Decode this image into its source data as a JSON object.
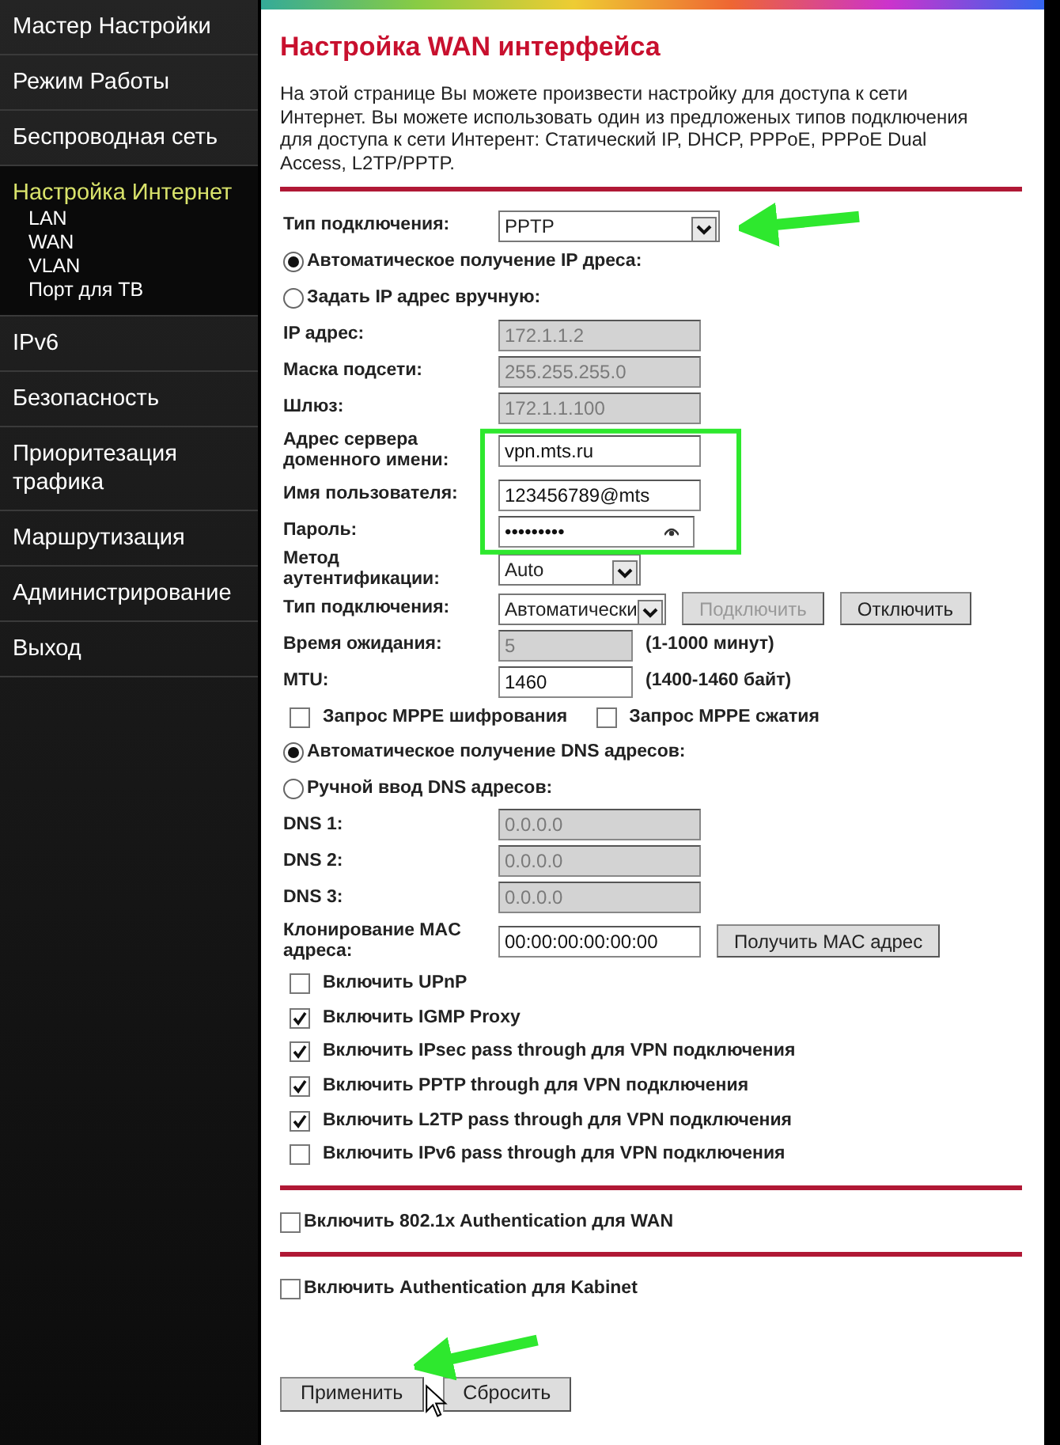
{
  "sidebar": {
    "items": [
      {
        "label": "Мастер Настройки",
        "selected": false
      },
      {
        "label": "Режим Работы",
        "selected": false
      },
      {
        "label": "Беспроводная сеть",
        "selected": false
      },
      {
        "label": "Настройка Интернет",
        "selected": true,
        "children": [
          {
            "label": "LAN"
          },
          {
            "label": "WAN"
          },
          {
            "label": "VLAN"
          },
          {
            "label": "Порт для ТВ"
          }
        ]
      },
      {
        "label": "IPv6",
        "selected": false
      },
      {
        "label": "Безопасность",
        "selected": false
      },
      {
        "label": "Приоритезация трафика",
        "selected": false
      },
      {
        "label": "Маршрутизация",
        "selected": false
      },
      {
        "label": "Администрирование",
        "selected": false
      },
      {
        "label": "Выход",
        "selected": false
      }
    ]
  },
  "page": {
    "title": "Настройка WAN интерфейса",
    "description": "На этой странице Вы можете произвести настройку для доступа к сети Интернет. Вы можете использовать один из предложеных типов подключения для доступа к сети Интерент: Статический IP, DHCP, PPPoE, PPPoE Dual Access, L2TP/PPTP."
  },
  "sections": [
    {
      "rows": [
        {
          "kind": "select",
          "label": "Тип подключения:",
          "value": "PPTP"
        },
        {
          "kind": "radio",
          "label": "Автоматическое получение IP дреса:",
          "selected": true
        },
        {
          "kind": "radio",
          "label": "Задать IP адрес вручную:",
          "selected": false
        },
        {
          "kind": "input",
          "label": "IP адрес:",
          "value": "172.1.1.2",
          "disabled": true
        },
        {
          "kind": "input",
          "label": "Маска подсети:",
          "value": "255.255.255.0",
          "disabled": true
        },
        {
          "kind": "input",
          "label": "Шлюз:",
          "value": "172.1.1.100",
          "disabled": true
        },
        {
          "kind": "input",
          "label": "Адрес сервера доменного имени:",
          "value": "vpn.mts.ru",
          "disabled": false
        },
        {
          "kind": "input",
          "label": "Имя пользователя:",
          "value": "123456789@mts",
          "disabled": false
        },
        {
          "kind": "password",
          "label": "Пароль:",
          "value": "•••••••••"
        },
        {
          "kind": "select",
          "label": "Метод аутентификации:",
          "value": "Auto"
        },
        {
          "kind": "select",
          "label": "Тип подключения:",
          "value": "Автоматически",
          "buttons": [
            {
              "label": "Подключить",
              "disabled": true
            },
            {
              "label": "Отключить",
              "disabled": false
            }
          ]
        },
        {
          "kind": "input",
          "label": "Время ожидания:",
          "value": "5",
          "disabled": true,
          "hint": "(1-1000 минут)"
        },
        {
          "kind": "input",
          "label": "MTU:",
          "value": "1460",
          "disabled": false,
          "hint": "(1400-1460 байт)"
        },
        {
          "kind": "checkboxes",
          "items": [
            {
              "label": "Запрос MPPE шифрования",
              "checked": false
            },
            {
              "label": "Запрос MPPE сжатия",
              "checked": false
            }
          ]
        },
        {
          "kind": "radio",
          "label": "Автоматическое получение DNS адресов:",
          "selected": true
        },
        {
          "kind": "radio",
          "label": "Ручной ввод DNS адресов:",
          "selected": false
        },
        {
          "kind": "input",
          "label": "DNS 1:",
          "value": "0.0.0.0",
          "disabled": true
        },
        {
          "kind": "input",
          "label": "DNS 2:",
          "value": "0.0.0.0",
          "disabled": true
        },
        {
          "kind": "input",
          "label": "DNS 3:",
          "value": "0.0.0.0",
          "disabled": true
        },
        {
          "kind": "input",
          "label": "Клонирование MAC адреса:",
          "value": "00:00:00:00:00:00",
          "disabled": false,
          "buttons": [
            {
              "label": "Получить MAC адрес",
              "disabled": false
            }
          ]
        },
        {
          "kind": "checkboxes",
          "items": [
            {
              "label": "Включить UPnP",
              "checked": false
            }
          ]
        },
        {
          "kind": "checkboxes",
          "items": [
            {
              "label": "Включить IGMP Proxy",
              "checked": true
            }
          ]
        },
        {
          "kind": "checkboxes",
          "items": [
            {
              "label": "Включить IPsec pass through для VPN подключения",
              "checked": true
            }
          ]
        },
        {
          "kind": "checkboxes",
          "items": [
            {
              "label": "Включить PPTP through для VPN подключения",
              "checked": true
            }
          ]
        },
        {
          "kind": "checkboxes",
          "items": [
            {
              "label": "Включить L2TP pass through для VPN подключения",
              "checked": true
            }
          ]
        },
        {
          "kind": "checkboxes",
          "items": [
            {
              "label": "Включить IPv6 pass through для VPN подключения",
              "checked": false
            }
          ]
        }
      ]
    },
    {
      "rows": [
        {
          "kind": "checkboxes",
          "items": [
            {
              "label": "Включить 802.1x Authentication для WAN",
              "checked": false
            }
          ]
        }
      ]
    },
    {
      "rows": [
        {
          "kind": "checkboxes",
          "items": [
            {
              "label": "Включить Authentication для Kabinet",
              "checked": false
            }
          ]
        }
      ]
    }
  ],
  "actions": [
    {
      "label": "Применить"
    },
    {
      "label": "Сбросить"
    }
  ]
}
